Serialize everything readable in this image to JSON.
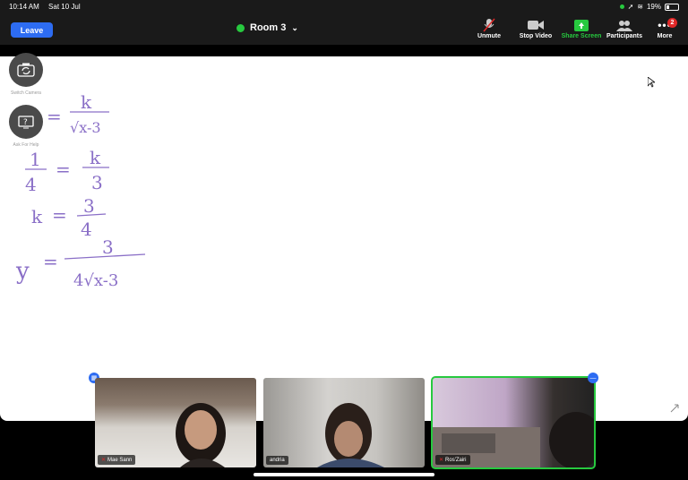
{
  "status_bar": {
    "time": "10:14 AM",
    "date": "Sat 10 Jul",
    "battery": "19%"
  },
  "header": {
    "leave_label": "Leave",
    "room_name": "Room 3",
    "toolbar": {
      "unmute": "Unmute",
      "stop_video": "Stop Video",
      "share_screen": "Share Screen",
      "participants": "Participants",
      "more": "More",
      "more_badge": "2"
    }
  },
  "side_controls": {
    "switch_camera": "Switch Camera",
    "ask_for_help": "Ask For Help"
  },
  "whiteboard_math": {
    "line1_rhs_num": "k",
    "line1_rhs_den": "√x-3",
    "line2_lhs_num": "1",
    "line2_lhs_den": "4",
    "line2_rhs_num": "k",
    "line2_rhs_den": "3",
    "line3_lhs": "k",
    "line3_num": "3",
    "line3_den": "4",
    "line4_lhs": "y",
    "line4_num": "3",
    "line4_den": "4√x-3",
    "eq": "="
  },
  "participants": [
    {
      "name": "Mae Sann",
      "muted": true
    },
    {
      "name": "andria",
      "muted": false
    },
    {
      "name": "Ros'Zairi",
      "muted": true
    }
  ],
  "colors": {
    "accent": "#2d6cf2",
    "share": "#27c93f",
    "ink": "#8a6fc7",
    "muted": "#e02828"
  }
}
